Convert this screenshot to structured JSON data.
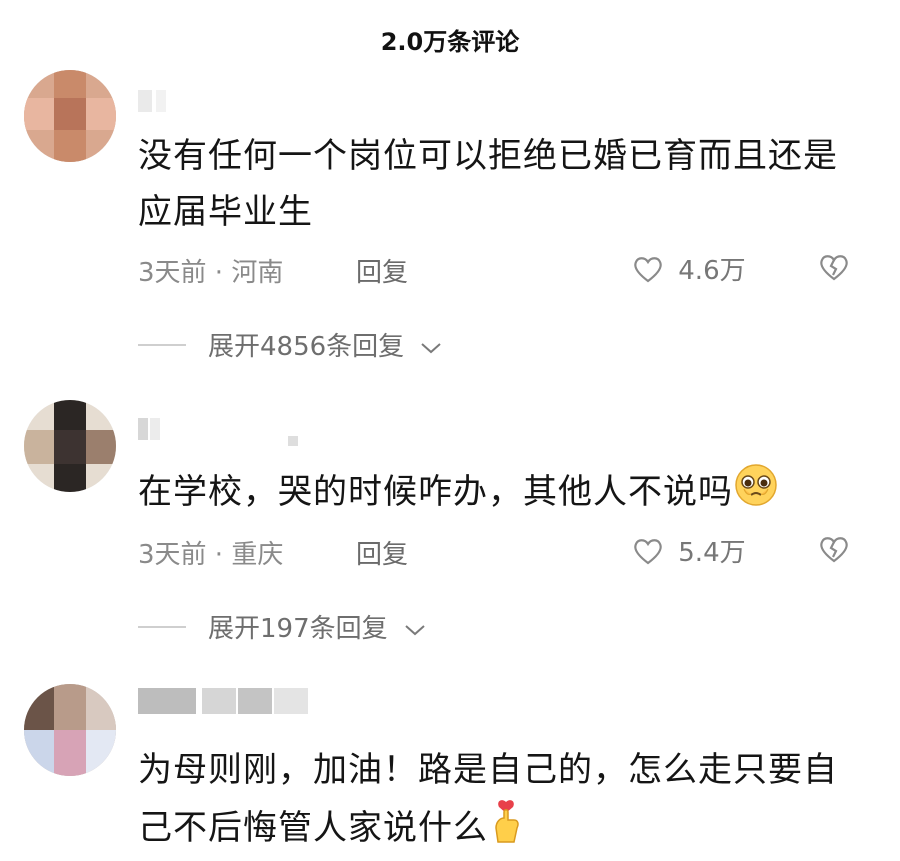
{
  "header": {
    "title": "2.0万条评论"
  },
  "comments": [
    {
      "text": "没有任何一个岗位可以拒绝已婚已育而且还是应届毕业生",
      "time_location": "3天前 · 河南",
      "reply_label": "回复",
      "likes": "4.6万",
      "expand_label": "展开4856条回复"
    },
    {
      "text": "在学校，哭的时候咋办，其他人不说吗",
      "emoji_icon": "pleading-face-icon",
      "time_location": "3天前 · 重庆",
      "reply_label": "回复",
      "likes": "5.4万",
      "expand_label": "展开197条回复"
    },
    {
      "text": "为母则刚，加油！路是自己的，怎么走只要自己不后悔管人家说什么",
      "emoji_icon": "finger-heart-icon"
    }
  ],
  "icons": {
    "like": "heart-outline-icon",
    "dislike": "broken-heart-icon",
    "expand": "chevron-down-icon"
  },
  "colors": {
    "meta_text": "#8a8a8a",
    "body_text": "#151515"
  }
}
